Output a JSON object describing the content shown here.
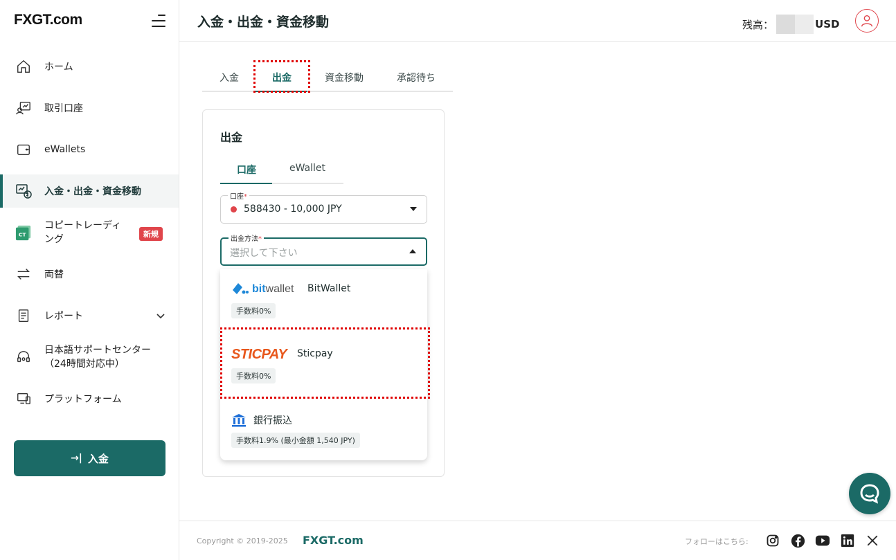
{
  "brand": {
    "logo": "FXGT.com"
  },
  "header": {
    "title": "入金・出金・資金移動",
    "balance_label": "残高：",
    "balance_currency": "USD"
  },
  "sidebar": {
    "items": [
      {
        "label": "ホーム",
        "icon": "home-icon"
      },
      {
        "label": "取引口座",
        "icon": "trading-account-icon"
      },
      {
        "label": "eWallets",
        "icon": "wallet-icon"
      },
      {
        "label": "入金・出金・資金移動",
        "icon": "transfer-funds-icon",
        "active": true
      },
      {
        "label": "コピートレーディング",
        "label_line1": "コピートレーディ",
        "label_line2": "ング",
        "icon": "copy-trading-icon",
        "badge": "新規"
      },
      {
        "label": "両替",
        "icon": "exchange-icon"
      },
      {
        "label": "レポート",
        "icon": "report-icon"
      },
      {
        "label_line1": "日本語サポートセンター",
        "label_line2": "（24時間対応中）",
        "icon": "support-headset-icon"
      },
      {
        "label": "プラットフォーム",
        "icon": "platform-icon"
      }
    ],
    "deposit_button": "入金"
  },
  "tabs": [
    {
      "label": "入金"
    },
    {
      "label": "出金",
      "active": true
    },
    {
      "label": "資金移動"
    },
    {
      "label": "承認待ち"
    }
  ],
  "card": {
    "title": "出金",
    "subtabs": [
      {
        "label": "口座",
        "active": true
      },
      {
        "label": "eWallet"
      }
    ],
    "account_field": {
      "label": "口座",
      "required": "*",
      "value": "588430 - 10,000 JPY"
    },
    "method_field": {
      "label": "出金方法",
      "required": "*",
      "placeholder": "選択して下さい"
    },
    "options": [
      {
        "logo_text_a": "bit",
        "logo_text_b": "wallet",
        "name": "BitWallet",
        "fee": "手数料0%"
      },
      {
        "logo_text": "STICPAY",
        "name": "Sticpay",
        "fee": "手数料0%"
      },
      {
        "name": "銀行振込",
        "fee": "手数料1.9% (最小金額 1,540 JPY)"
      }
    ]
  },
  "footer": {
    "copyright": "Copyright © 2019-2025",
    "brand": "FXGT.com",
    "follow": "フォローはこちら:"
  },
  "colors": {
    "accent": "#1b6a66",
    "danger": "#e0454b",
    "highlight": "#e00000"
  }
}
